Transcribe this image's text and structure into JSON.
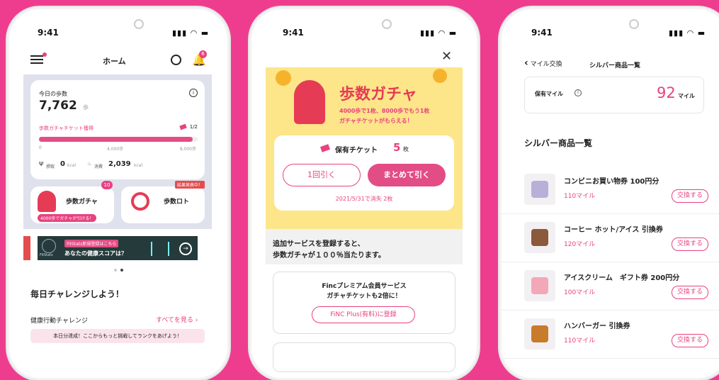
{
  "status_time": "9:41",
  "phone1": {
    "title": "ホーム",
    "badge_count": "6",
    "steps_label": "今日の歩数",
    "steps_value": "7,762",
    "steps_unit": "歩",
    "ticket_progress_label": "歩数ガチャチケット獲得",
    "ticket_count": "1/2",
    "progress_fraction": 0.97,
    "scale_min": "0",
    "scale_mid": "4,000歩",
    "scale_max": "8,000歩",
    "intake_label": "摂取",
    "intake_value": "0",
    "intake_unit": "kcal",
    "burn_label": "消費",
    "burn_value": "2,039",
    "burn_unit": "kcal",
    "gacha_label": "歩数ガチャ",
    "gacha_badge": "10",
    "gacha_sub": "4000歩でガチャが引ける！",
    "lotto_label": "歩数ロト",
    "lotto_badge": "結果発表中！",
    "banner_tag": "FitStats新規登録はこちら",
    "banner_text": "あなたの健康スコアは？",
    "banner_logo": "FitStats",
    "challenge_title": "毎日チャレンジしよう！",
    "health_challenge": "健康行動チャレンジ",
    "see_all": "すべてを見る",
    "challenge_msg": "本日分達成！ここからもっと挑戦してランクをあげよう！"
  },
  "phone2": {
    "close": "✕",
    "gacha_title": "歩数ガチャ",
    "gacha_desc1": "4000歩で1枚、8000歩でもう1枚",
    "gacha_desc2": "ガチャチケットがもらえる！",
    "owned_label": "保有チケット",
    "owned_count": "5",
    "owned_unit": "枚",
    "draw_once": "1回引く",
    "draw_all": "まとめて引く",
    "expiry": "2021/5/31で消失 2枚",
    "promo1": "追加サービスを登録すると、",
    "promo2": "歩数ガチャが１００％当たります。",
    "premium1": "Fincプレミアム会員サービス",
    "premium2": "ガチャチケットも2倍に！",
    "register": "FiNC Plus(有料)に登録"
  },
  "phone3": {
    "back_label": "マイル交換",
    "page_title": "シルバー商品一覧",
    "miles_label": "保有マイル",
    "miles_value": "92",
    "miles_unit": "マイル",
    "section_title": "シルバー商品一覧",
    "exchange_label": "交換する",
    "items": [
      {
        "name": "コンビニお買い物券 100円分",
        "price": "110マイル"
      },
      {
        "name": "コーヒー ホット/アイス 引換券",
        "price": "120マイル"
      },
      {
        "name": "アイスクリーム　ギフト券 200円分",
        "price": "100マイル"
      },
      {
        "name": "ハンバーガー 引換券",
        "price": "110マイル"
      }
    ]
  }
}
